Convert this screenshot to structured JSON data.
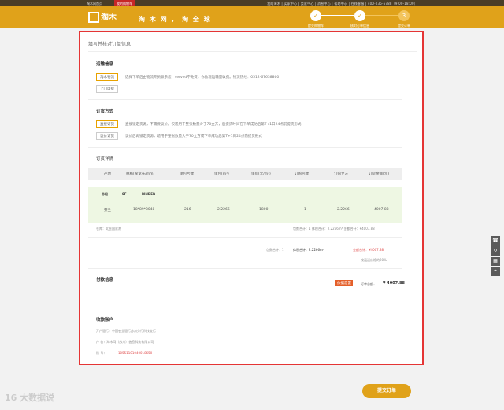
{
  "topbar": {
    "home": "淘木网首页",
    "red_link": "我的购物车",
    "right": "我的淘木 | 买家中心 | 卖家中心 | 消息中心 | 帮助中心 | 在线客服 | 400-035-5788（9:00-18:00）"
  },
  "header": {
    "logo": "淘木",
    "slogan": "淘 木 网 ， 淘 全 球",
    "steps": [
      {
        "num": "✓",
        "label": "提交购物车"
      },
      {
        "num": "✓",
        "label": "核对订单信息"
      },
      {
        "num": "3",
        "label": "提交订单"
      }
    ]
  },
  "page": {
    "title": "填写并核对订单信息",
    "shipping": {
      "title": "运输信息",
      "options": [
        "淘木物流",
        "上门自提"
      ],
      "desc": "选择下单后由物流专员联系您，served不免费，你数现运输量收费。物流热线：0512-67638860"
    },
    "ordering": {
      "title": "订货方式",
      "options": [
        "直接订货",
        "议价订货"
      ],
      "desc1": "直接锁定货源，不需要议价。仅适用于整张数量少于70立方，后提货时间在下单成功后第T+1日24点前提货形式",
      "desc2": "议价后再锁定货源，适用于整张数量大于70立方或下单成功后第T+1日24点前提货形式"
    },
    "detail": {
      "title": "订货详情",
      "headers": [
        "产地",
        "规格(厚宽长/mm)",
        "单包片数",
        "单包(m³)",
        "单价(元/m³)",
        "订购包数",
        "订购立方",
        "订货金额(元)"
      ],
      "product": {
        "name": "赤松",
        "grade": "SF",
        "brand": "BINDER"
      },
      "row": [
        "芬兰",
        "18*89*3048",
        "216",
        "2.2266",
        "1800",
        "1",
        "2.2266",
        "4007.88"
      ],
      "warehouse": "仓库：太仓国家港",
      "sub_total": "包数合计：1   体积合计：2.2266m³   金额合计：¥4007.88",
      "grand_count": "包数合计：1",
      "grand_volume": "体积合计：2.2266m³",
      "grand_amount": "金额合计：¥4007.88",
      "note": "按运送价格的20%"
    },
    "payment": {
      "title": "付款信息",
      "button": "依据前置",
      "amount_label": "订单总额：",
      "amount": "¥ 4007.88"
    },
    "account": {
      "title": "收款账户",
      "bank": "开户银行：中国农业银行苏州分行科技支行",
      "holder": "户     名：淘木网（苏州）信息科技有限公司",
      "number_label": "账     号：",
      "number": "10551101040018650"
    }
  },
  "submit": "提交订单",
  "watermark": "16 大数据说"
}
